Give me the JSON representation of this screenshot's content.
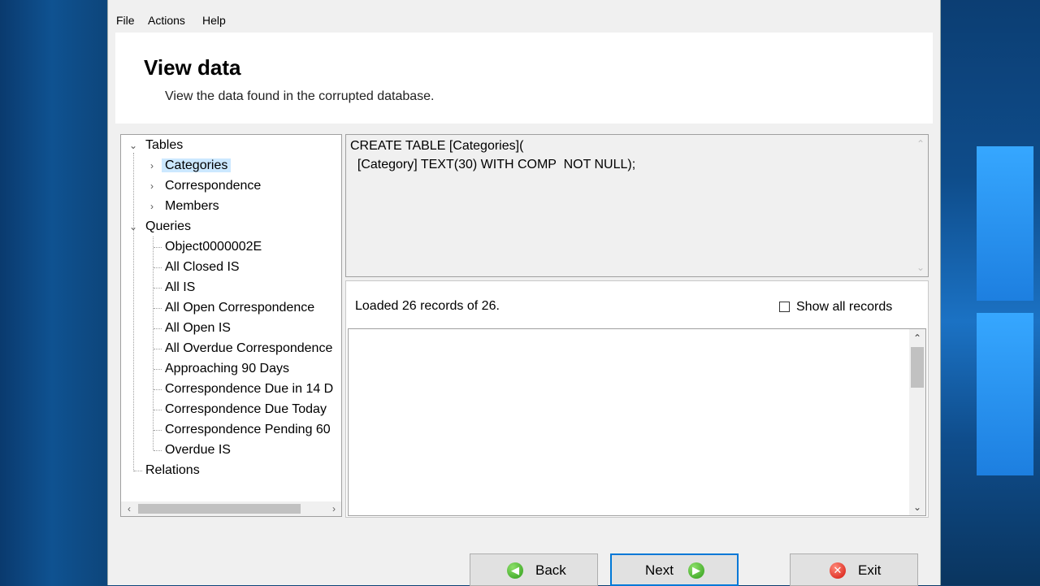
{
  "menu": {
    "items": [
      "File",
      "Actions",
      "Help"
    ]
  },
  "header": {
    "title": "View data",
    "subtitle": "View the data found in the corrupted database."
  },
  "tree": {
    "tables_label": "Tables",
    "tables": [
      "Categories",
      "Correspondence",
      "Members"
    ],
    "selected": "Categories",
    "queries_label": "Queries",
    "queries": [
      "Object0000002E",
      "All Closed IS",
      "All IS",
      "All Open Correspondence",
      "All Open IS",
      "All Overdue Correspondence",
      "Approaching 90 Days",
      "Correspondence Due in 14 D",
      "Correspondence Due Today",
      "Correspondence Pending 60",
      "Overdue IS"
    ],
    "relations_label": "Relations"
  },
  "sql": {
    "line1": "CREATE TABLE [Categories](",
    "line2": "  [Category] TEXT(30) WITH COMP  NOT NULL);"
  },
  "records": {
    "loaded_text": "Loaded 26 records of 26.",
    "show_all_label": "Show all records",
    "show_all_checked": false
  },
  "buttons": {
    "back": "Back",
    "next": "Next",
    "exit": "Exit"
  },
  "colors": {
    "selection": "#cce8ff",
    "default_button_border": "#0078d7",
    "green_icon": "#2f9d1a",
    "red_icon": "#d4140b"
  }
}
